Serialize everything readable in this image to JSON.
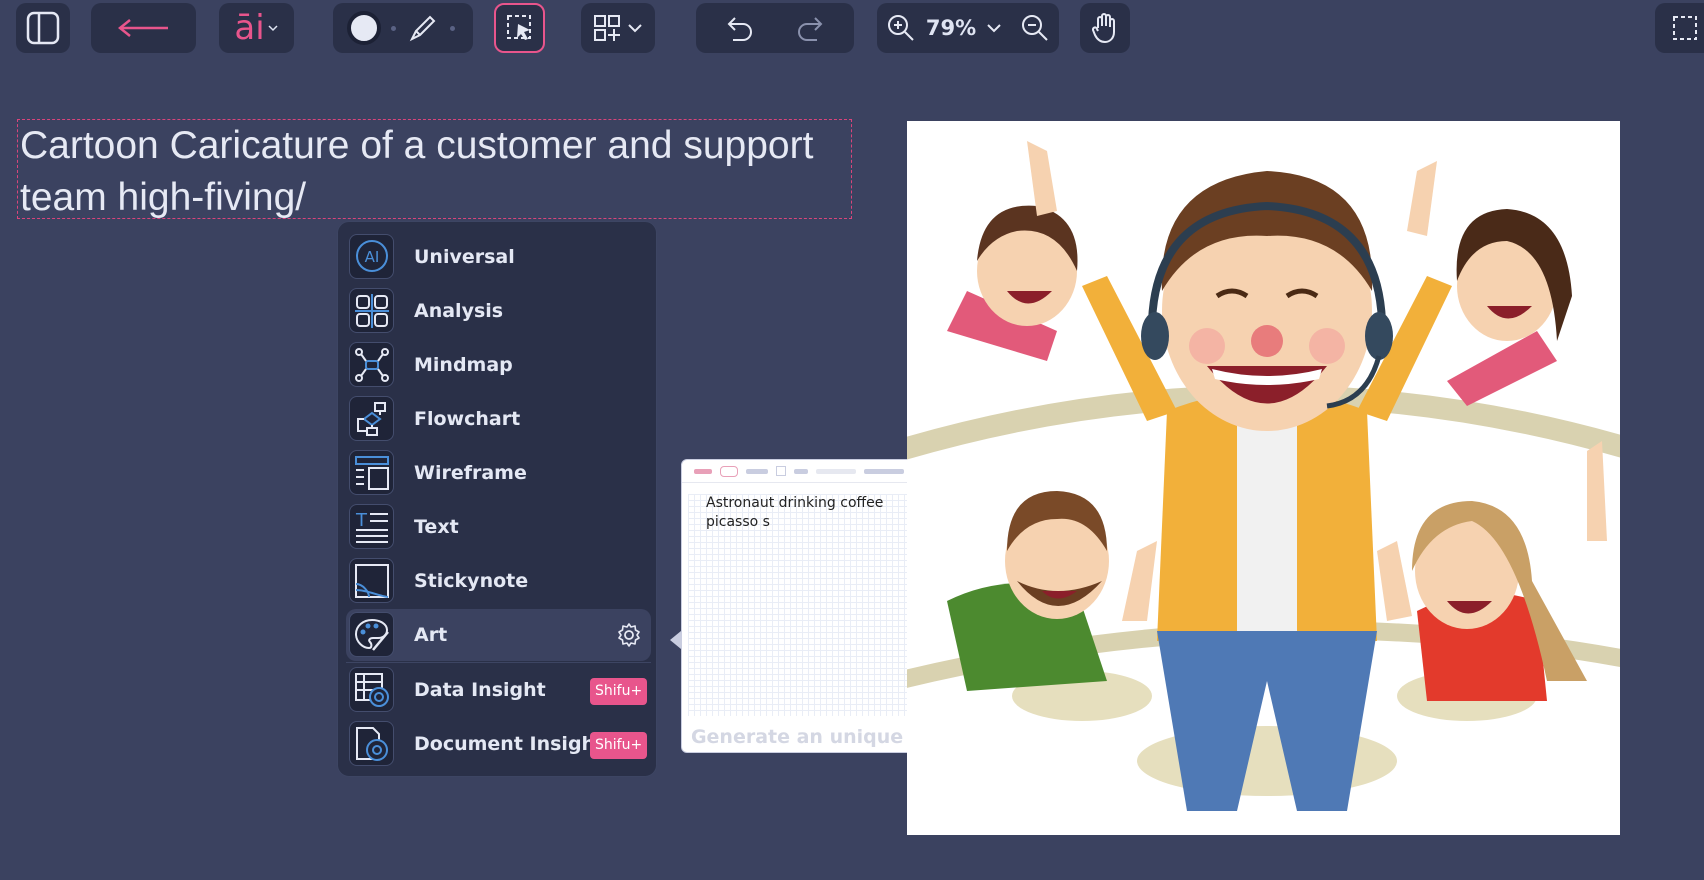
{
  "toolbar": {
    "ai_label": "āi",
    "zoom_level": "79%"
  },
  "canvas": {
    "text": "Cartoon Caricature of a customer and support team high-fiving/"
  },
  "menu": {
    "items": [
      {
        "label": "Universal",
        "icon": "ai-chat-icon"
      },
      {
        "label": "Analysis",
        "icon": "grid-icon"
      },
      {
        "label": "Mindmap",
        "icon": "mindmap-icon"
      },
      {
        "label": "Flowchart",
        "icon": "flowchart-icon"
      },
      {
        "label": "Wireframe",
        "icon": "wireframe-icon"
      },
      {
        "label": "Text",
        "icon": "text-icon"
      },
      {
        "label": "Stickynote",
        "icon": "stickynote-icon"
      },
      {
        "label": "Art",
        "icon": "palette-icon",
        "active": true
      },
      {
        "label": "Data Insight",
        "icon": "data-insight-icon",
        "badge": "Shifu+"
      },
      {
        "label": "Document Insight",
        "icon": "document-insight-icon",
        "badge": "Shifu+"
      }
    ]
  },
  "preview": {
    "prompt": "Astronaut drinking coffee picasso s",
    "hint": "Generate an unique art"
  },
  "colors": {
    "background": "#3b4260",
    "panel": "#2a3048",
    "accent_pink": "#e8558c",
    "icon_blue": "#4a8fd9"
  }
}
